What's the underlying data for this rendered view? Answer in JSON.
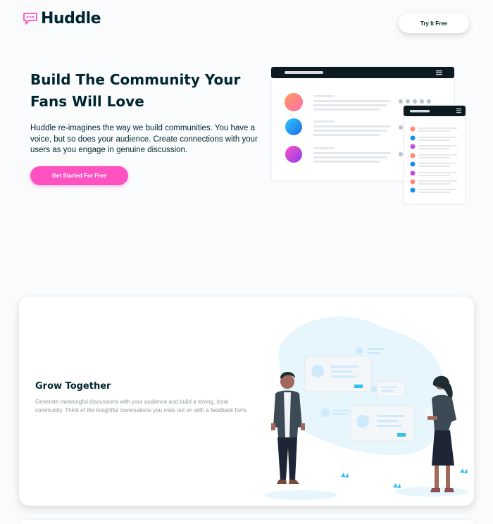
{
  "header": {
    "brand": "Huddle",
    "try_button": "Try It Free"
  },
  "hero": {
    "title": "Build The Community Your Fans Will Love",
    "description": "Huddle re-imagines the way we build communities. You have a voice, but so does your audience. Create connections with your users as you engage in genuine discussion.",
    "cta": "Get Started For Free"
  },
  "feature": {
    "title": "Grow Together",
    "description": "Generate meaningful discussions with your audience and build a strong, loyal community. Think of the insightful coversations you miss out on with a feedback form."
  },
  "colors": {
    "accent": "#ff52c1",
    "text_dark": "#00252e",
    "text_muted": "#8b9ba0",
    "illustration_dark": "#0b1b20"
  },
  "icons": {
    "logo": "chat-bubble-icon",
    "menu": "hamburger-menu-icon"
  }
}
